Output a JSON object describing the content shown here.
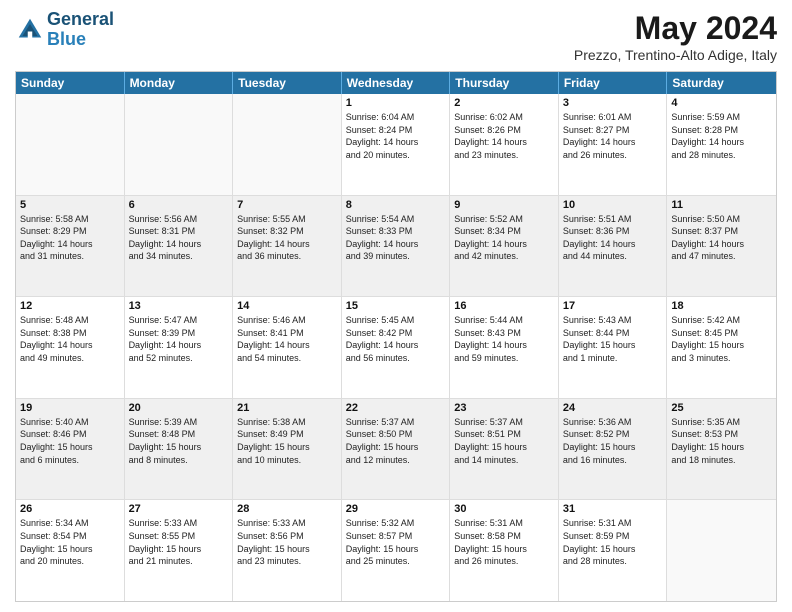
{
  "header": {
    "logo_line1": "General",
    "logo_line2": "Blue",
    "month_title": "May 2024",
    "location": "Prezzo, Trentino-Alto Adige, Italy"
  },
  "weekdays": [
    "Sunday",
    "Monday",
    "Tuesday",
    "Wednesday",
    "Thursday",
    "Friday",
    "Saturday"
  ],
  "rows": [
    [
      {
        "day": "",
        "text": ""
      },
      {
        "day": "",
        "text": ""
      },
      {
        "day": "",
        "text": ""
      },
      {
        "day": "1",
        "text": "Sunrise: 6:04 AM\nSunset: 8:24 PM\nDaylight: 14 hours\nand 20 minutes."
      },
      {
        "day": "2",
        "text": "Sunrise: 6:02 AM\nSunset: 8:26 PM\nDaylight: 14 hours\nand 23 minutes."
      },
      {
        "day": "3",
        "text": "Sunrise: 6:01 AM\nSunset: 8:27 PM\nDaylight: 14 hours\nand 26 minutes."
      },
      {
        "day": "4",
        "text": "Sunrise: 5:59 AM\nSunset: 8:28 PM\nDaylight: 14 hours\nand 28 minutes."
      }
    ],
    [
      {
        "day": "5",
        "text": "Sunrise: 5:58 AM\nSunset: 8:29 PM\nDaylight: 14 hours\nand 31 minutes."
      },
      {
        "day": "6",
        "text": "Sunrise: 5:56 AM\nSunset: 8:31 PM\nDaylight: 14 hours\nand 34 minutes."
      },
      {
        "day": "7",
        "text": "Sunrise: 5:55 AM\nSunset: 8:32 PM\nDaylight: 14 hours\nand 36 minutes."
      },
      {
        "day": "8",
        "text": "Sunrise: 5:54 AM\nSunset: 8:33 PM\nDaylight: 14 hours\nand 39 minutes."
      },
      {
        "day": "9",
        "text": "Sunrise: 5:52 AM\nSunset: 8:34 PM\nDaylight: 14 hours\nand 42 minutes."
      },
      {
        "day": "10",
        "text": "Sunrise: 5:51 AM\nSunset: 8:36 PM\nDaylight: 14 hours\nand 44 minutes."
      },
      {
        "day": "11",
        "text": "Sunrise: 5:50 AM\nSunset: 8:37 PM\nDaylight: 14 hours\nand 47 minutes."
      }
    ],
    [
      {
        "day": "12",
        "text": "Sunrise: 5:48 AM\nSunset: 8:38 PM\nDaylight: 14 hours\nand 49 minutes."
      },
      {
        "day": "13",
        "text": "Sunrise: 5:47 AM\nSunset: 8:39 PM\nDaylight: 14 hours\nand 52 minutes."
      },
      {
        "day": "14",
        "text": "Sunrise: 5:46 AM\nSunset: 8:41 PM\nDaylight: 14 hours\nand 54 minutes."
      },
      {
        "day": "15",
        "text": "Sunrise: 5:45 AM\nSunset: 8:42 PM\nDaylight: 14 hours\nand 56 minutes."
      },
      {
        "day": "16",
        "text": "Sunrise: 5:44 AM\nSunset: 8:43 PM\nDaylight: 14 hours\nand 59 minutes."
      },
      {
        "day": "17",
        "text": "Sunrise: 5:43 AM\nSunset: 8:44 PM\nDaylight: 15 hours\nand 1 minute."
      },
      {
        "day": "18",
        "text": "Sunrise: 5:42 AM\nSunset: 8:45 PM\nDaylight: 15 hours\nand 3 minutes."
      }
    ],
    [
      {
        "day": "19",
        "text": "Sunrise: 5:40 AM\nSunset: 8:46 PM\nDaylight: 15 hours\nand 6 minutes."
      },
      {
        "day": "20",
        "text": "Sunrise: 5:39 AM\nSunset: 8:48 PM\nDaylight: 15 hours\nand 8 minutes."
      },
      {
        "day": "21",
        "text": "Sunrise: 5:38 AM\nSunset: 8:49 PM\nDaylight: 15 hours\nand 10 minutes."
      },
      {
        "day": "22",
        "text": "Sunrise: 5:37 AM\nSunset: 8:50 PM\nDaylight: 15 hours\nand 12 minutes."
      },
      {
        "day": "23",
        "text": "Sunrise: 5:37 AM\nSunset: 8:51 PM\nDaylight: 15 hours\nand 14 minutes."
      },
      {
        "day": "24",
        "text": "Sunrise: 5:36 AM\nSunset: 8:52 PM\nDaylight: 15 hours\nand 16 minutes."
      },
      {
        "day": "25",
        "text": "Sunrise: 5:35 AM\nSunset: 8:53 PM\nDaylight: 15 hours\nand 18 minutes."
      }
    ],
    [
      {
        "day": "26",
        "text": "Sunrise: 5:34 AM\nSunset: 8:54 PM\nDaylight: 15 hours\nand 20 minutes."
      },
      {
        "day": "27",
        "text": "Sunrise: 5:33 AM\nSunset: 8:55 PM\nDaylight: 15 hours\nand 21 minutes."
      },
      {
        "day": "28",
        "text": "Sunrise: 5:33 AM\nSunset: 8:56 PM\nDaylight: 15 hours\nand 23 minutes."
      },
      {
        "day": "29",
        "text": "Sunrise: 5:32 AM\nSunset: 8:57 PM\nDaylight: 15 hours\nand 25 minutes."
      },
      {
        "day": "30",
        "text": "Sunrise: 5:31 AM\nSunset: 8:58 PM\nDaylight: 15 hours\nand 26 minutes."
      },
      {
        "day": "31",
        "text": "Sunrise: 5:31 AM\nSunset: 8:59 PM\nDaylight: 15 hours\nand 28 minutes."
      },
      {
        "day": "",
        "text": ""
      }
    ]
  ]
}
